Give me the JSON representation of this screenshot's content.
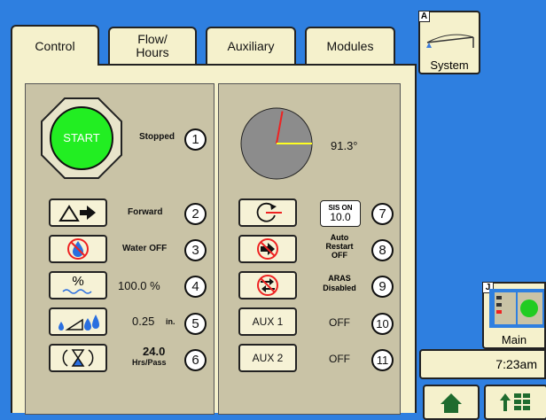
{
  "tabs": [
    {
      "label": "Control"
    },
    {
      "label": "Flow/\nHours"
    },
    {
      "label": "Auxiliary"
    },
    {
      "label": "Modules"
    }
  ],
  "system_button": {
    "label": "System",
    "corner_letter": "A"
  },
  "main_button": {
    "label": "Main",
    "corner_letter": "J"
  },
  "clock": "7:23am",
  "start_button": {
    "label": "START"
  },
  "status": {
    "text": "Stopped",
    "number": "1"
  },
  "direction": {
    "text": "Forward",
    "number": "2"
  },
  "water": {
    "text": "Water OFF",
    "number": "3"
  },
  "percent": {
    "icon_text": "%",
    "text": "100.0 %",
    "number": "4"
  },
  "application": {
    "text": "0.25",
    "unit": "in.",
    "number": "5"
  },
  "hours": {
    "value": "24.0",
    "unit": "Hrs/Pass",
    "number": "6"
  },
  "position": {
    "angle_text": "91.3°",
    "angle_deg": 91.3
  },
  "sis": {
    "line1": "SIS ON",
    "line2": "10.0",
    "number": "7"
  },
  "auto_restart": {
    "line1": "Auto",
    "line2": "Restart",
    "line3": "OFF",
    "number": "8"
  },
  "aras": {
    "line1": "ARAS",
    "line2": "Disabled",
    "number": "9"
  },
  "aux1": {
    "label": "AUX 1",
    "state": "OFF",
    "number": "10"
  },
  "aux2": {
    "label": "AUX 2",
    "state": "OFF",
    "number": "11"
  },
  "colors": {
    "background": "#2e7fe0",
    "start_green": "#22ee22",
    "panel": "#c9c3a6",
    "tab": "#f5f1cc"
  }
}
